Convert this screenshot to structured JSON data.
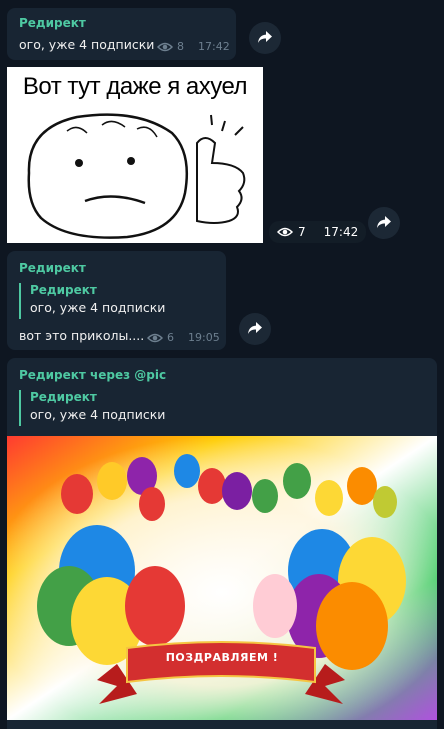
{
  "messages": [
    {
      "sender": "Редирект",
      "text": "ого, уже 4 подписки",
      "views": "8",
      "time": "17:42"
    },
    {
      "meme_caption": "Вот тут даже я ахуел",
      "views": "7",
      "time": "17:42"
    },
    {
      "sender": "Редирект",
      "reply_sender": "Редирект",
      "reply_text": "ого, уже 4 подписки",
      "text": "вот это приколы....",
      "views": "6",
      "time": "19:05"
    },
    {
      "sender": "Редирект через @pic",
      "reply_sender": "Редирект",
      "reply_text": "ого, уже 4 подписки",
      "banner_text": "ПОЗДРАВЛЯЕМ !"
    }
  ],
  "icons": {
    "views": "eye-icon",
    "forward": "forward-arrow-icon"
  },
  "colors": {
    "background": "#0e1621",
    "bubble": "#182533",
    "accent": "#4ec9a2"
  }
}
